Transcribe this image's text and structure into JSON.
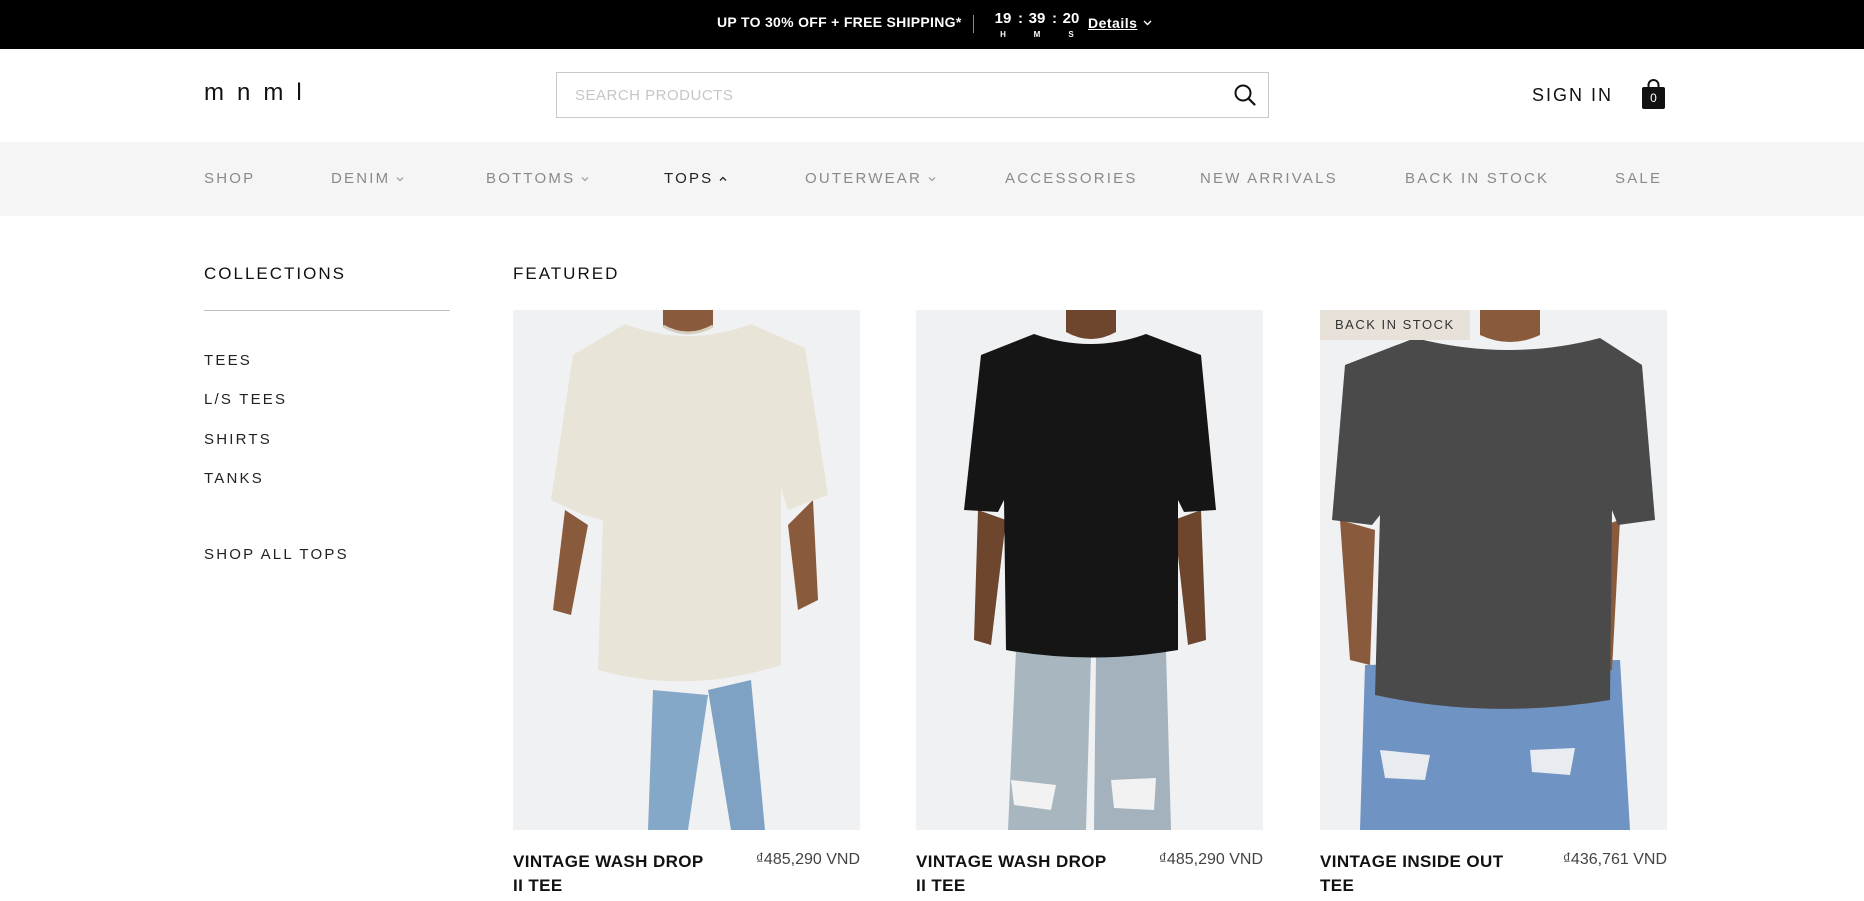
{
  "promo": {
    "text": "UP TO 30% OFF + FREE SHIPPING*",
    "timer": {
      "hours": "19",
      "minutes": "39",
      "seconds": "20",
      "hours_label": "H",
      "minutes_label": "M",
      "seconds_label": "S",
      "separator": ":"
    },
    "details_label": "Details"
  },
  "header": {
    "logo": "mnml",
    "search_placeholder": "SEARCH PRODUCTS",
    "sign_in": "SIGN IN",
    "cart_count": "0"
  },
  "nav": {
    "items": [
      {
        "label": "SHOP",
        "dropdown": false
      },
      {
        "label": "DENIM",
        "dropdown": true
      },
      {
        "label": "BOTTOMS",
        "dropdown": true
      },
      {
        "label": "TOPS",
        "dropdown": true,
        "active": true
      },
      {
        "label": "OUTERWEAR",
        "dropdown": true
      },
      {
        "label": "ACCESSORIES",
        "dropdown": false
      },
      {
        "label": "NEW ARRIVALS",
        "dropdown": false
      },
      {
        "label": "BACK IN STOCK",
        "dropdown": false
      },
      {
        "label": "SALE",
        "dropdown": false
      }
    ]
  },
  "menu": {
    "collections_title": "COLLECTIONS",
    "collections": [
      "TEES",
      "L/S TEES",
      "SHIRTS",
      "TANKS"
    ],
    "shop_all": "SHOP ALL TOPS",
    "featured_title": "FEATURED",
    "products": [
      {
        "name": "VINTAGE WASH DROP II TEE",
        "price": "₫485,290 VND",
        "badge": "",
        "shirt_color": "#e9e4d8"
      },
      {
        "name": "VINTAGE WASH DROP II TEE",
        "price": "₫485,290 VND",
        "badge": "",
        "shirt_color": "#151515"
      },
      {
        "name": "VINTAGE INSIDE OUT TEE",
        "price": "₫436,761 VND",
        "badge": "BACK IN STOCK",
        "shirt_color": "#4a4a4a"
      }
    ]
  },
  "colors": {
    "promo_bg": "#000000",
    "nav_bg": "#f5f5f5",
    "badge_bg": "#e7e1da",
    "product_bg": "#f0f1f3",
    "skin": "#8a5a3c",
    "denim": "#7fa2c4"
  }
}
